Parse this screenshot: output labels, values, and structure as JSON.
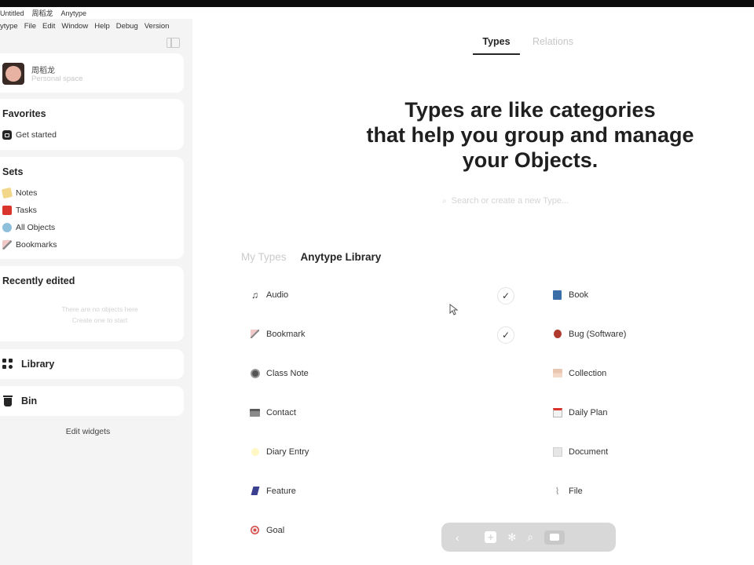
{
  "titlebar": {
    "parts": [
      "Untitled",
      "周稻龙",
      "Anytype"
    ]
  },
  "menubar": {
    "items": [
      "ytype",
      "File",
      "Edit",
      "Window",
      "Help",
      "Debug",
      "Version"
    ]
  },
  "sidebar": {
    "toggle_icon": "sidebar-toggle-icon",
    "space": {
      "name": "周稻龙",
      "subtitle": "Personal space"
    },
    "favorites": {
      "title": "Favorites",
      "items": [
        {
          "label": "Get started",
          "icon": "get-started-icon"
        }
      ]
    },
    "sets": {
      "title": "Sets",
      "items": [
        {
          "label": "Notes",
          "icon": "note-icon"
        },
        {
          "label": "Tasks",
          "icon": "task-icon"
        },
        {
          "label": "All Objects",
          "icon": "globe-icon"
        },
        {
          "label": "Bookmarks",
          "icon": "bookmark-icon"
        }
      ]
    },
    "recent": {
      "title": "Recently edited",
      "empty_line1": "There are no objects here",
      "empty_line2": "Create one to start"
    },
    "library": {
      "label": "Library",
      "icon": "library-icon"
    },
    "bin": {
      "label": "Bin",
      "icon": "bin-icon"
    },
    "edit_widgets": "Edit widgets"
  },
  "main": {
    "tabs": [
      {
        "label": "Types",
        "active": true
      },
      {
        "label": "Relations",
        "active": false
      }
    ],
    "hero": {
      "line1": "Types are like categories",
      "line2": "that help you group and manage",
      "line3": "your Objects."
    },
    "search_placeholder": "Search or create a new Type...",
    "library_tabs": [
      {
        "label": "My Types",
        "active": false
      },
      {
        "label": "Anytype Library",
        "active": true
      }
    ],
    "left_types": [
      {
        "label": "Audio",
        "icon": "music-note-icon",
        "installed": true
      },
      {
        "label": "Bookmark",
        "icon": "bookmark-icon",
        "installed": true
      },
      {
        "label": "Class Note",
        "icon": "class-note-icon",
        "installed": false
      },
      {
        "label": "Contact",
        "icon": "contact-icon",
        "installed": false
      },
      {
        "label": "Diary Entry",
        "icon": "diary-icon",
        "installed": false
      },
      {
        "label": "Feature",
        "icon": "feature-icon",
        "installed": false
      },
      {
        "label": "Goal",
        "icon": "goal-icon",
        "installed": false
      }
    ],
    "right_types": [
      {
        "label": "Book",
        "icon": "book-icon"
      },
      {
        "label": "Bug (Software)",
        "icon": "bug-icon"
      },
      {
        "label": "Collection",
        "icon": "collection-icon"
      },
      {
        "label": "Daily Plan",
        "icon": "calendar-icon"
      },
      {
        "label": "Document",
        "icon": "document-icon"
      },
      {
        "label": "File",
        "icon": "paperclip-icon"
      }
    ],
    "check_symbol": "✓"
  },
  "dock": {
    "icons": [
      "back-arrow-icon",
      "forward-arrow-icon",
      "plus-icon",
      "graph-icon",
      "search-icon",
      "space-icon"
    ]
  },
  "colors": {
    "sidebar_bg": "#f4f4f4",
    "card_bg": "#ffffff",
    "text": "#252525",
    "muted": "#c8c8c8",
    "dock_bg": "#d8d8d8"
  }
}
